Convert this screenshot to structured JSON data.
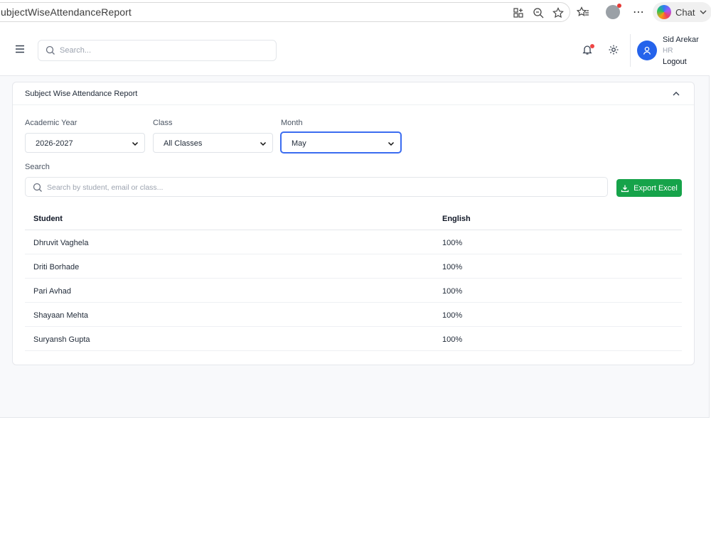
{
  "browser": {
    "url_text": "ubjectWiseAttendanceReport",
    "chat_label": "Chat",
    "icons": [
      "apps-icon",
      "zoom-icon",
      "star-icon",
      "favorites-icon",
      "profile-icon",
      "more-icon",
      "copilot-icon",
      "chevron-down-icon"
    ]
  },
  "header": {
    "search_placeholder": "Search...",
    "user": {
      "name": "Sid Arekar",
      "role": "HR",
      "logout_label": "Logout"
    }
  },
  "card": {
    "title": "Subject Wise Attendance Report",
    "filters": {
      "academic_year": {
        "label": "Academic Year",
        "value": "2026-2027"
      },
      "class": {
        "label": "Class",
        "value": "All Classes"
      },
      "month": {
        "label": "Month",
        "value": "May"
      }
    },
    "search": {
      "label": "Search",
      "placeholder": "Search by student, email or class..."
    },
    "export_label": "Export Excel"
  },
  "table": {
    "columns": [
      "Student",
      "English"
    ],
    "rows": [
      {
        "student": "Dhruvit Vaghela",
        "english": "100%"
      },
      {
        "student": "Driti Borhade",
        "english": "100%"
      },
      {
        "student": "Pari Avhad",
        "english": "100%"
      },
      {
        "student": "Shayaan Mehta",
        "english": "100%"
      },
      {
        "student": "Suryansh Gupta",
        "english": "100%"
      }
    ]
  },
  "colors": {
    "primary": "#2563eb",
    "export": "#16a34a",
    "active_border": "#3b6cf0",
    "notification": "#ef4444"
  }
}
